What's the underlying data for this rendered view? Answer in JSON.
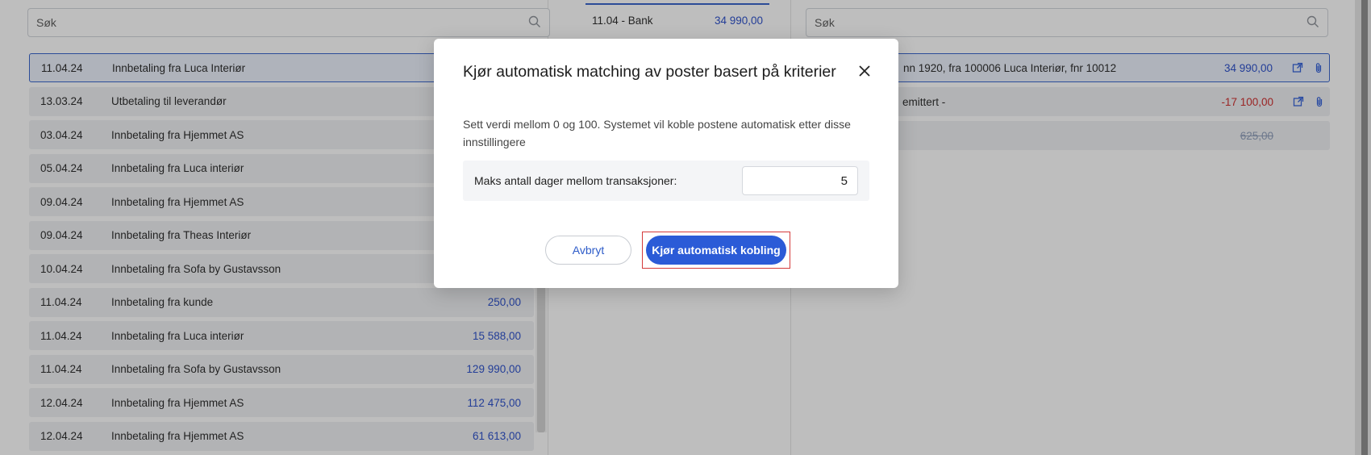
{
  "left": {
    "search_placeholder": "Søk",
    "rows": [
      {
        "date": "11.04.24",
        "desc": "Innbetaling fra Luca Interiør",
        "amount": ""
      },
      {
        "date": "13.03.24",
        "desc": "Utbetaling til leverandør",
        "amount": ""
      },
      {
        "date": "03.04.24",
        "desc": "Innbetaling fra Hjemmet AS",
        "amount": ""
      },
      {
        "date": "05.04.24",
        "desc": "Innbetaling fra Luca interiør",
        "amount": ""
      },
      {
        "date": "09.04.24",
        "desc": "Innbetaling fra Hjemmet AS",
        "amount": ""
      },
      {
        "date": "09.04.24",
        "desc": "Innbetaling fra Theas Interiør",
        "amount": ""
      },
      {
        "date": "10.04.24",
        "desc": "Innbetaling fra Sofa by Gustavsson",
        "amount": ""
      },
      {
        "date": "11.04.24",
        "desc": "Innbetaling fra kunde",
        "amount": "250,00"
      },
      {
        "date": "11.04.24",
        "desc": "Innbetaling fra Luca interiør",
        "amount": "15 588,00"
      },
      {
        "date": "11.04.24",
        "desc": "Innbetaling fra Sofa by Gustavsson",
        "amount": "129 990,00"
      },
      {
        "date": "12.04.24",
        "desc": "Innbetaling fra Hjemmet AS",
        "amount": "112 475,00"
      },
      {
        "date": "12.04.24",
        "desc": "Innbetaling fra Hjemmet AS",
        "amount": "61 613,00"
      }
    ]
  },
  "middle": {
    "item_label": "11.04 - Bank",
    "item_amount": "34 990,00"
  },
  "right": {
    "search_placeholder": "Søk",
    "rows": [
      {
        "text": "nn 1920, fra 100006 Luca Interiør, fnr 10012",
        "amount": "34 990,00"
      },
      {
        "text": "emittert -",
        "amount": "-17 100,00"
      },
      {
        "text": "",
        "amount": "625,00"
      }
    ]
  },
  "modal": {
    "title": "Kjør automatisk matching av poster basert på kriterier",
    "description": "Sett verdi mellom 0 og 100. Systemet vil koble postene automatisk etter disse innstillingere",
    "field_label": "Maks antall dager mellom transaksjoner:",
    "field_value": "5",
    "cancel_label": "Avbryt",
    "run_label": "Kjør automatisk kobling"
  },
  "colors": {
    "accent": "#2b5bd7",
    "positive_amount": "#2147c8",
    "negative_amount": "#cc2323",
    "highlight_border": "#d43a3a"
  }
}
